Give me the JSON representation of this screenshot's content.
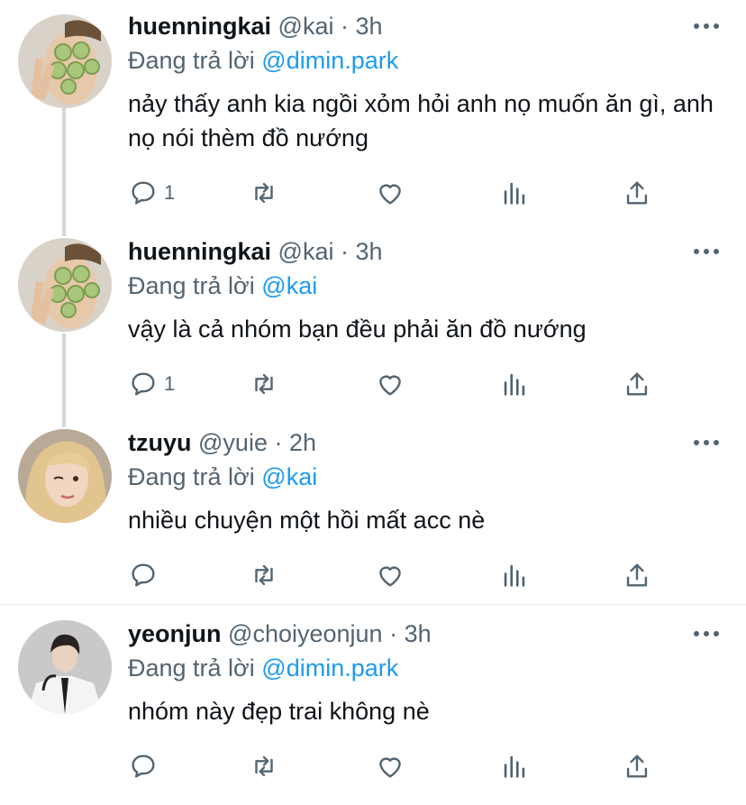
{
  "tweets": [
    {
      "name": "huenningkai",
      "handle": "@kai",
      "dot": "·",
      "time": "3h",
      "reply_prefix": "Đang trả lời",
      "reply_to": "@dimin.park",
      "text": "nảy thấy anh kia ngồi xỏm hỏi anh nọ muốn ăn gì, anh nọ nói thèm đồ nướng",
      "reply_count": "1",
      "avatar": "cucumber-mask-avatar"
    },
    {
      "name": "huenningkai",
      "handle": "@kai",
      "dot": "·",
      "time": "3h",
      "reply_prefix": "Đang trả lời",
      "reply_to": "@kai",
      "text": "vậy là cả nhóm bạn đều phải ăn đồ nướng",
      "reply_count": "1",
      "avatar": "cucumber-mask-avatar"
    },
    {
      "name": "tzuyu",
      "handle": "@yuie",
      "dot": "·",
      "time": "2h",
      "reply_prefix": "Đang trả lời",
      "reply_to": "@kai",
      "text": "nhiều chuyện một hồi mất acc nè",
      "reply_count": "",
      "avatar": "blonde-girl-avatar"
    },
    {
      "name": "yeonjun",
      "handle": "@choiyeonjun",
      "dot": "·",
      "time": "3h",
      "reply_prefix": "Đang trả lời",
      "reply_to": "@dimin.park",
      "text": "nhóm này đẹp trai không nè",
      "reply_count": "",
      "avatar": "suit-boy-avatar"
    }
  ],
  "icons": {
    "reply": "reply-icon",
    "retweet": "retweet-icon",
    "like": "like-icon",
    "analytics": "analytics-icon",
    "share": "share-icon",
    "more": "more-icon"
  },
  "colors": {
    "link": "#1d9bf0",
    "secondary": "#536471",
    "thread_line": "#cfd9de"
  }
}
